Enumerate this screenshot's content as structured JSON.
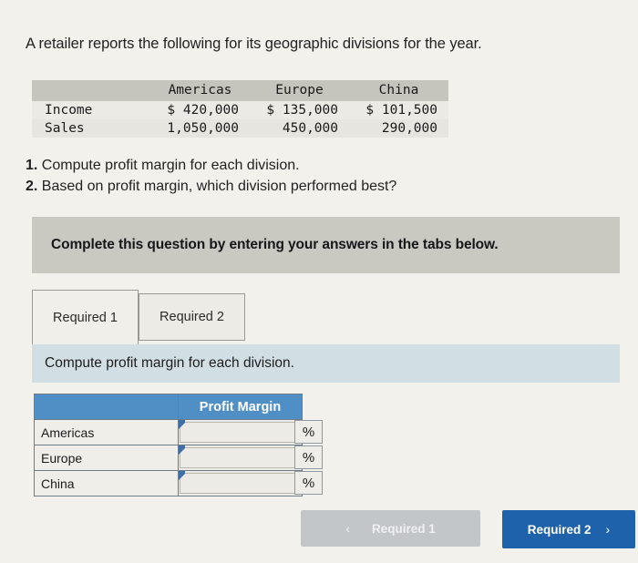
{
  "prompt": "A retailer reports the following for its geographic divisions for the year.",
  "given_table": {
    "columns": [
      "",
      "Americas",
      "Europe",
      "China"
    ],
    "rows": [
      {
        "label": "Income",
        "values": [
          "$ 420,000",
          "$ 135,000",
          "$ 101,500"
        ]
      },
      {
        "label": "Sales",
        "values": [
          "1,050,000",
          "450,000",
          "290,000"
        ]
      }
    ]
  },
  "requirements": [
    {
      "num": "1.",
      "text": "Compute profit margin for each division."
    },
    {
      "num": "2.",
      "text": "Based on profit margin, which division performed best?"
    }
  ],
  "banner": {
    "text": "Complete this question by entering your answers in the tabs below."
  },
  "tabs": [
    {
      "label": "Required 1",
      "active": true
    },
    {
      "label": "Required 2",
      "active": false
    }
  ],
  "subbar": {
    "text": "Compute profit margin for each division."
  },
  "answer_table": {
    "header_blank": "",
    "header_margin": "Profit Margin",
    "rows": [
      {
        "label": "Americas",
        "value": "",
        "unit": "%"
      },
      {
        "label": "Europe",
        "value": "",
        "unit": "%"
      },
      {
        "label": "China",
        "value": "",
        "unit": "%"
      }
    ]
  },
  "footer": {
    "prev_label": "Required 1",
    "prev_chevron": "‹",
    "next_label": "Required 2",
    "next_chevron": "›"
  },
  "colors": {
    "page_background": "#f3f1ec",
    "banner_grey": "#c9c8c1",
    "subbar_blue": "#d1dee3",
    "table_header_blue": "#4f8fc6",
    "primary_button_blue": "#1d62ab",
    "disabled_button_grey": "#c3c6c8",
    "given_header_grey": "#c5c4bd"
  }
}
